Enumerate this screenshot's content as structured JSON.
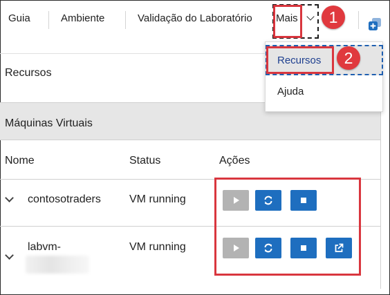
{
  "nav": {
    "items": [
      "Guia",
      "Ambiente",
      "Validação do Laboratório"
    ],
    "more_label": "Mais"
  },
  "callouts": [
    "1",
    "2"
  ],
  "dropdown": {
    "items": [
      "Recursos",
      "Ajuda"
    ],
    "highlighted": "Recursos"
  },
  "page": {
    "section_title": "Recursos",
    "panel_title": "Máquinas Virtuais",
    "columns": [
      "Nome",
      "Status",
      "Ações"
    ],
    "rows": [
      {
        "name": "contosotraders",
        "status": "VM running",
        "actions": [
          "play-icon",
          "refresh-icon",
          "stop-icon"
        ]
      },
      {
        "name": "labvm-",
        "status": "VM running",
        "actions": [
          "play-icon",
          "refresh-icon",
          "stop-icon",
          "external-link-icon"
        ]
      }
    ]
  },
  "colors": {
    "annotation_red": "#d9363e",
    "action_blue": "#1e6ebf",
    "disabled_gray": "#b3b3b3",
    "dropdown_highlight": "#e5e5e5",
    "focus_dash": "#1f5fb0"
  }
}
